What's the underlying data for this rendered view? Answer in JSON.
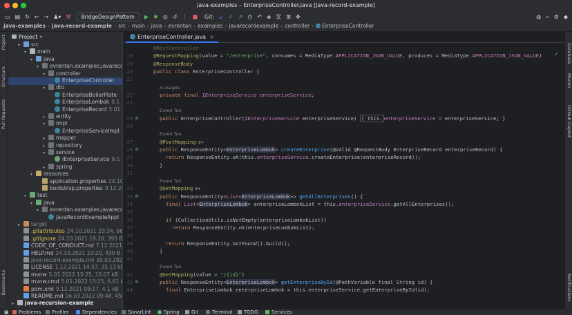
{
  "window": {
    "title": "java-examples – EnterpriseController.java [java-record-example]",
    "buttons": [
      "close",
      "minimize",
      "maximize"
    ]
  },
  "toolbar": {
    "run_config": "BridgeDesignPattern",
    "git_label": "Git:"
  },
  "breadcrumb": [
    "java-examples",
    "java-record-example",
    "src",
    "main",
    "java",
    "evrentan",
    "examples",
    "javarecordexample",
    "controller",
    "EnterpriseController"
  ],
  "left_stripe": [
    "Project",
    "Structure",
    "Pull Requests",
    "Bookmarks"
  ],
  "right_stripe": [
    "Database",
    "Maven",
    "GitHub Copilot",
    "Notifications"
  ],
  "project": {
    "header": "Project",
    "tree": [
      {
        "indent": 2,
        "arrow": "▾",
        "icon": "folder-src",
        "label": "src",
        "meta": "",
        "color": ""
      },
      {
        "indent": 3,
        "arrow": "▾",
        "icon": "folder",
        "label": "main",
        "meta": "",
        "color": ""
      },
      {
        "indent": 4,
        "arrow": "▾",
        "icon": "folder-src",
        "label": "java",
        "meta": "",
        "color": ""
      },
      {
        "indent": 5,
        "arrow": "▾",
        "icon": "pkg",
        "label": "evrentan.examples.javarecord",
        "meta": "",
        "color": ""
      },
      {
        "indent": 6,
        "arrow": "▾",
        "icon": "pkg",
        "label": "controller",
        "meta": "",
        "color": ""
      },
      {
        "indent": 7,
        "arrow": "",
        "icon": "class",
        "label": "EnterpriseController",
        "meta": "",
        "color": "",
        "selected": true
      },
      {
        "indent": 6,
        "arrow": "▾",
        "icon": "pkg",
        "label": "dto",
        "meta": "",
        "color": ""
      },
      {
        "indent": 7,
        "arrow": "",
        "icon": "class",
        "label": "EnterpriseBoilerPlate",
        "meta": "",
        "color": ""
      },
      {
        "indent": 7,
        "arrow": "",
        "icon": "class",
        "label": "EnterpriseLombok",
        "meta": "9.1",
        "color": ""
      },
      {
        "indent": 7,
        "arrow": "",
        "icon": "record",
        "label": "EnterpriseRecord",
        "meta": "5.01",
        "color": ""
      },
      {
        "indent": 6,
        "arrow": "▸",
        "icon": "pkg",
        "label": "entity",
        "meta": "",
        "color": ""
      },
      {
        "indent": 6,
        "arrow": "▾",
        "icon": "pkg",
        "label": "impl",
        "meta": "",
        "color": ""
      },
      {
        "indent": 7,
        "arrow": "",
        "icon": "class",
        "label": "EnterpriseServiceImpl",
        "meta": "",
        "color": ""
      },
      {
        "indent": 6,
        "arrow": "▸",
        "icon": "pkg",
        "label": "mapper",
        "meta": "",
        "color": ""
      },
      {
        "indent": 6,
        "arrow": "▸",
        "icon": "pkg",
        "label": "repository",
        "meta": "",
        "color": ""
      },
      {
        "indent": 6,
        "arrow": "▾",
        "icon": "pkg",
        "label": "service",
        "meta": "",
        "color": ""
      },
      {
        "indent": 7,
        "arrow": "",
        "icon": "iface",
        "label": "IEnterpriseService",
        "meta": "9.1",
        "color": ""
      },
      {
        "indent": 6,
        "arrow": "▸",
        "icon": "pkg",
        "label": "spring",
        "meta": "",
        "color": ""
      },
      {
        "indent": 4,
        "arrow": "▾",
        "icon": "folder-res",
        "label": "resources",
        "meta": "",
        "color": ""
      },
      {
        "indent": 5,
        "arrow": "",
        "icon": "prop",
        "label": "application.properties",
        "meta": "24.10",
        "color": ""
      },
      {
        "indent": 5,
        "arrow": "",
        "icon": "prop",
        "label": "bootstrap.properties",
        "meta": "9.12.20",
        "color": ""
      },
      {
        "indent": 3,
        "arrow": "▾",
        "icon": "folder-test",
        "label": "test",
        "meta": "",
        "color": ""
      },
      {
        "indent": 4,
        "arrow": "▾",
        "icon": "folder-test",
        "label": "java",
        "meta": "",
        "color": ""
      },
      {
        "indent": 5,
        "arrow": "▾",
        "icon": "pkg",
        "label": "evrentan.examples.javarecord",
        "meta": "",
        "color": ""
      },
      {
        "indent": 6,
        "arrow": "",
        "icon": "class",
        "label": "JavaRecordExampleAppl",
        "meta": "",
        "color": ""
      },
      {
        "indent": 2,
        "arrow": "▸",
        "icon": "folder-target",
        "label": "target",
        "meta": "",
        "color": "gray"
      },
      {
        "indent": 2,
        "arrow": "",
        "icon": "file",
        "label": ".gitattributes",
        "meta": "24.10.2021 20:34, 66 B",
        "color": ""
      },
      {
        "indent": 2,
        "arrow": "",
        "icon": "file",
        "label": ".gitignore",
        "meta": "24.10.2021 19:20, 395 B",
        "color": ""
      },
      {
        "indent": 2,
        "arrow": "",
        "icon": "md",
        "label": "CODE_OF_CONDUCT.md",
        "meta": "7.12.2021 1",
        "color": ""
      },
      {
        "indent": 2,
        "arrow": "",
        "icon": "md",
        "label": "HELP.md",
        "meta": "24.10.2021 19:20, 430 B",
        "color": ""
      },
      {
        "indent": 2,
        "arrow": "",
        "icon": "file",
        "label": "java-record-example.iml",
        "meta": "30.03.2023",
        "color": "gray"
      },
      {
        "indent": 2,
        "arrow": "",
        "icon": "file",
        "label": "LICENSE",
        "meta": "1.12.2021 14:57, 35.13 kB",
        "color": ""
      },
      {
        "indent": 2,
        "arrow": "",
        "icon": "file",
        "label": "mvnw",
        "meta": "5.01.2022 15:25, 10.07 kB",
        "color": ""
      },
      {
        "indent": 2,
        "arrow": "",
        "icon": "file",
        "label": "mvnw.cmd",
        "meta": "5.01.2022 15:25, 6.61 kB",
        "color": ""
      },
      {
        "indent": 2,
        "arrow": "",
        "icon": "xml",
        "label": "pom.xml",
        "meta": "9.12.2021 09:17, 4.1 kB",
        "color": ""
      },
      {
        "indent": 2,
        "arrow": "",
        "icon": "md",
        "label": "README.md",
        "meta": "16.03.2022 09:48, 458 B",
        "color": ""
      },
      {
        "indent": 1,
        "arrow": "▸",
        "icon": "folder",
        "label": "java-recursion-example",
        "meta": "",
        "color": "module"
      }
    ]
  },
  "editor": {
    "tab_label": "EnterpriseController.java",
    "lines": [
      {
        "n": "",
        "kind": "partial",
        "text": "@RestController"
      },
      {
        "n": "18",
        "html_key": "l18"
      },
      {
        "n": "19",
        "html_key": "l19"
      },
      {
        "n": "20",
        "html_key": "l20"
      },
      {
        "n": "21",
        "html_key": "blank"
      },
      {
        "n": "",
        "html_key": "usages"
      },
      {
        "n": "22",
        "html_key": "l22"
      },
      {
        "n": "23",
        "html_key": "blank"
      },
      {
        "n": "",
        "html_key": "author"
      },
      {
        "n": "24",
        "html_key": "l24"
      },
      {
        "n": "26",
        "html_key": "blank"
      },
      {
        "n": "",
        "html_key": "author"
      },
      {
        "n": "27",
        "html_key": "l27"
      },
      {
        "n": "28",
        "html_key": "l28"
      },
      {
        "n": "29",
        "html_key": "l29"
      },
      {
        "n": "30",
        "html_key": "l30"
      },
      {
        "n": "31",
        "html_key": "blank"
      },
      {
        "n": "",
        "html_key": "author"
      },
      {
        "n": "32",
        "html_key": "l32"
      },
      {
        "n": "33",
        "html_key": "l33"
      },
      {
        "n": "34",
        "html_key": "l34"
      },
      {
        "n": "35",
        "html_key": "blank"
      },
      {
        "n": "36",
        "html_key": "l36"
      },
      {
        "n": "37",
        "html_key": "l37"
      },
      {
        "n": "38",
        "html_key": "blank"
      },
      {
        "n": "39",
        "html_key": "l39"
      },
      {
        "n": "40",
        "html_key": "l40"
      },
      {
        "n": "41",
        "html_key": "blank"
      },
      {
        "n": "",
        "html_key": "author"
      },
      {
        "n": "42",
        "html_key": "l42"
      },
      {
        "n": "43",
        "html_key": "l43"
      },
      {
        "n": "44",
        "html_key": "l44"
      }
    ],
    "segments": {
      "usages": "4 usages",
      "author": "Evren Tan",
      "l18_ann": "@RequestMapping",
      "l18_a": "(value = ",
      "l18_str": "\"/enterprise\"",
      "l18_b": ", consumes = MediaType.",
      "l18_c1": "APPLICATION_JSON_VALUE",
      "l18_d": ", produces = MediaType.",
      "l18_c2": "APPLICATION_JSON_VALUE",
      "l18_e": ")",
      "l19": "@ResponseBody",
      "l20_kw": "public class ",
      "l20_name": "EnterpriseController",
      "l20_end": " {",
      "l22_kw": "private final ",
      "l22_type": "IEnterpriseService",
      "l22_fld": " enterpriseService",
      "l22_end": ";",
      "l24_kw": "public ",
      "l24_name": "EnterpriseController(",
      "l24_type": "IEnterpriseService",
      "l24_param": " enterpriseService) ",
      "l24_body_a": "{ this.",
      "l24_body_f": "enterpriseService",
      "l24_body_b": " = enterpriseService; }",
      "l27": "@PostMapping",
      "l28_kw": "public ",
      "l28_a": "ResponseEntity<",
      "l28_t": "EnterpriseLombok",
      "l28_b": "> ",
      "l28_m": "createEnterprise",
      "l28_c": "(@Valid @RequestBody ",
      "l28_t2": "EnterpriseRecord",
      "l28_d": " enterpriseRecord) {",
      "l29_kw": "return ",
      "l29_a": "ResponseEntity.",
      "l29_m": "ok",
      "l29_b": "(this.",
      "l29_f": "enterpriseService",
      "l29_c": ".createEnterprise(enterpriseRecord));",
      "l30": "}",
      "l32": "@GetMapping",
      "l33_kw": "public ",
      "l33_a": "ResponseEntity<",
      "l33_l": "List",
      "l33_b": "<",
      "l33_t": "EnterpriseLombok",
      "l33_c": ">> ",
      "l33_m": "getAllEnterprises",
      "l33_d": "() {",
      "l34_kw": "final ",
      "l34_l": "List",
      "l34_a": "<",
      "l34_t": "EnterpriseLombok",
      "l34_b": "> enterpriseLombokList = this.",
      "l34_f": "enterpriseService",
      "l34_c": ".getAllEnterprises();",
      "l36_kw": "if ",
      "l36_a": "(CollectionUtils.",
      "l36_s": "isNotEmpty",
      "l36_b": "(enterpriseLombokList))",
      "l37_kw": "return ",
      "l37_a": "ResponseEntity.",
      "l37_m": "ok",
      "l37_b": "(enterpriseLombokList);",
      "l39_kw": "return ",
      "l39_a": "ResponseEntity.",
      "l39_m": "notFound",
      "l39_b": "().build();",
      "l40": "}",
      "l42_ann": "@GetMapping",
      "l42_a": "(value = ",
      "l42_str": "\"/{id}\"",
      "l42_b": ")",
      "l43_kw": "public ",
      "l43_a": "ResponseEntity<",
      "l43_t": "EnterpriseLombok",
      "l43_b": "> ",
      "l43_m": "getEnterpriseById",
      "l43_c": "(@PathVariable final ",
      "l43_s": "String",
      "l43_d": " id) {",
      "l44_kw": "final ",
      "l44_a": "EnterpriseLombok enterpriseLombok = this.enterpriseService.getEnterpriseById(id);"
    }
  },
  "statusbar": {
    "items": [
      "Problems",
      "Profiler",
      "Dependencies",
      "SonarLint",
      "Spring",
      "Git",
      "Terminal",
      "TODO",
      "Services"
    ]
  },
  "colors": {
    "accent": "#3574f0",
    "selection": "#2e436e",
    "background": "#1e1f22",
    "panel": "#2b2d30",
    "traffic_red": "#ff5f57",
    "traffic_yellow": "#febc2e",
    "traffic_green": "#28c840"
  }
}
